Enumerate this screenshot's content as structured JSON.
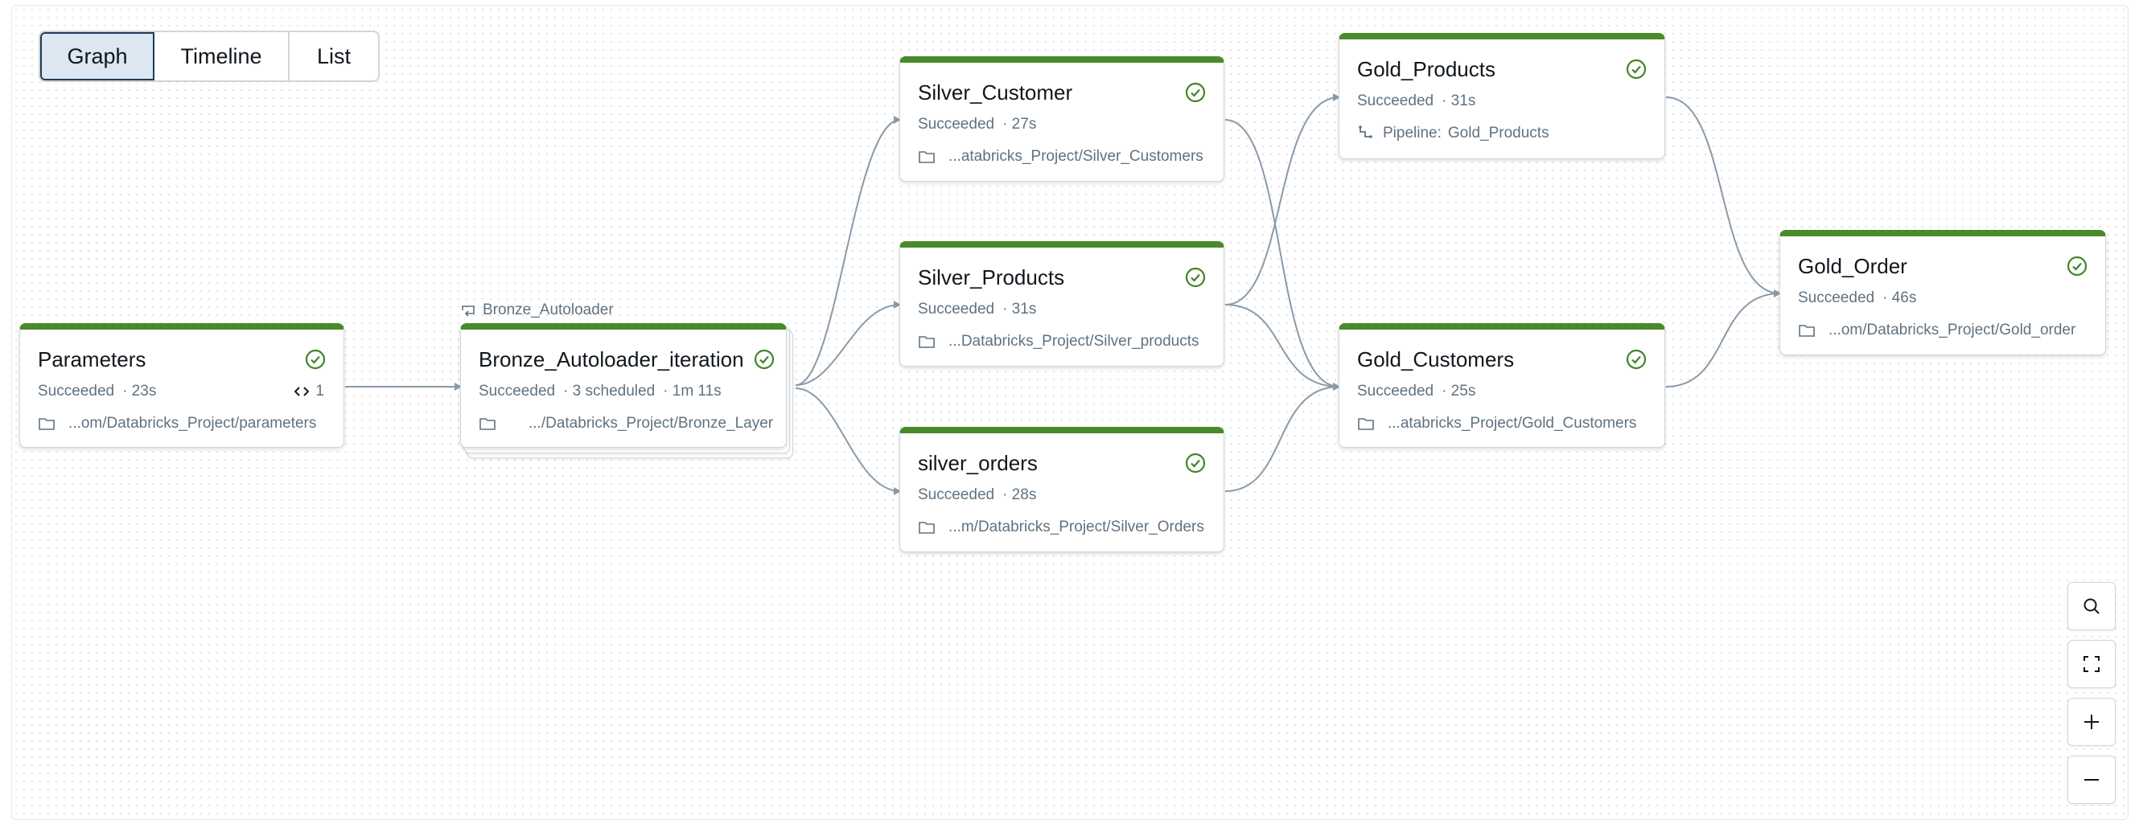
{
  "view_tabs": [
    {
      "label": "Graph",
      "active": true
    },
    {
      "label": "Timeline",
      "active": false
    },
    {
      "label": "List",
      "active": false
    }
  ],
  "colors": {
    "success_bar": "#4a8a2a",
    "success_icon": "#3f8624",
    "edge": "#8a9aa8",
    "active_tab_bg": "#dce7f2"
  },
  "nodes": {
    "parameters": {
      "title": "Parameters",
      "status": "Succeeded",
      "duration": "· 23s",
      "counter": "1",
      "path": "...om/Databricks_Project/parameters",
      "icon": "folder-icon"
    },
    "bronze": {
      "parent_label": "Bronze_Autoloader",
      "title": "Bronze_Autoloader_iteration",
      "status": "Succeeded",
      "scheduled": "· 3 scheduled",
      "duration": "· 1m 11s",
      "path": ".../Databricks_Project/Bronze_Layer",
      "icon": "folder-icon"
    },
    "silver_customer": {
      "title": "Silver_Customer",
      "status": "Succeeded",
      "duration": "· 27s",
      "path": "...atabricks_Project/Silver_Customers",
      "icon": "folder-icon"
    },
    "silver_products": {
      "title": "Silver_Products",
      "status": "Succeeded",
      "duration": "· 31s",
      "path": "...Databricks_Project/Silver_products",
      "icon": "folder-icon"
    },
    "silver_orders": {
      "title": "silver_orders",
      "status": "Succeeded",
      "duration": "· 28s",
      "path": "...m/Databricks_Project/Silver_Orders",
      "icon": "folder-icon"
    },
    "gold_products": {
      "title": "Gold_Products",
      "status": "Succeeded",
      "duration": "· 31s",
      "pipeline_label": "Pipeline:",
      "pipeline_name": "Gold_Products",
      "icon": "pipeline-icon"
    },
    "gold_customers": {
      "title": "Gold_Customers",
      "status": "Succeeded",
      "duration": "· 25s",
      "path": "...atabricks_Project/Gold_Customers",
      "icon": "folder-icon"
    },
    "gold_order": {
      "title": "Gold_Order",
      "status": "Succeeded",
      "duration": "· 46s",
      "path": "...om/Databricks_Project/Gold_order",
      "icon": "folder-icon"
    }
  },
  "controls": [
    "search-icon",
    "fit-view-icon",
    "zoom-in-icon",
    "zoom-out-icon"
  ]
}
